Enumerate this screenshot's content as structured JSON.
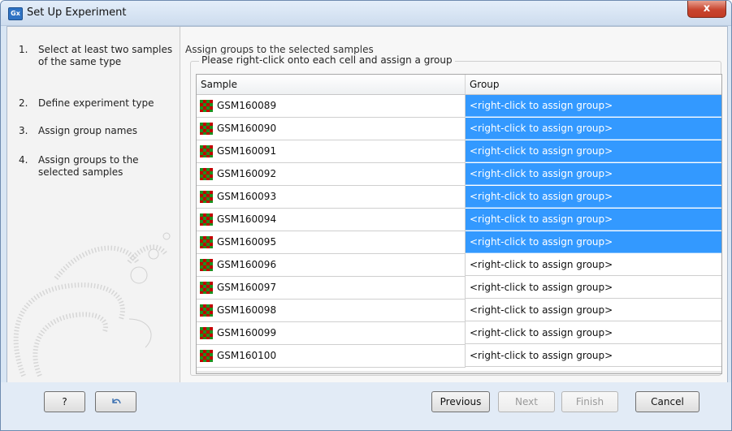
{
  "window": {
    "app_icon_text": "Gx",
    "title": "Set Up Experiment",
    "close_symbol": "x"
  },
  "sidebar": {
    "steps": [
      {
        "num": "1.",
        "label": "Select at least two samples of the same type"
      },
      {
        "num": "2.",
        "label": "Define experiment type"
      },
      {
        "num": "3.",
        "label": "Assign group names"
      },
      {
        "num": "4.",
        "label": "Assign groups to the selected samples"
      }
    ]
  },
  "main": {
    "heading": "Assign groups to the selected samples",
    "group_label": "Please right-click onto each cell and assign a group",
    "columns": [
      "Sample",
      "Group"
    ],
    "rows": [
      {
        "sample": "GSM160089",
        "group": "<right-click to assign group>",
        "selected": true
      },
      {
        "sample": "GSM160090",
        "group": "<right-click to assign group>",
        "selected": true
      },
      {
        "sample": "GSM160091",
        "group": "<right-click to assign group>",
        "selected": true
      },
      {
        "sample": "GSM160092",
        "group": "<right-click to assign group>",
        "selected": true
      },
      {
        "sample": "GSM160093",
        "group": "<right-click to assign group>",
        "selected": true
      },
      {
        "sample": "GSM160094",
        "group": "<right-click to assign group>",
        "selected": true
      },
      {
        "sample": "GSM160095",
        "group": "<right-click to assign group>",
        "selected": true
      },
      {
        "sample": "GSM160096",
        "group": "<right-click to assign group>",
        "selected": false
      },
      {
        "sample": "GSM160097",
        "group": "<right-click to assign group>",
        "selected": false
      },
      {
        "sample": "GSM160098",
        "group": "<right-click to assign group>",
        "selected": false
      },
      {
        "sample": "GSM160099",
        "group": "<right-click to assign group>",
        "selected": false
      },
      {
        "sample": "GSM160100",
        "group": "<right-click to assign group>",
        "selected": false
      }
    ]
  },
  "footer": {
    "help_label": "?",
    "reset_icon": "undo-arrow-icon",
    "previous_label": "Previous",
    "next_label": "Next",
    "finish_label": "Finish",
    "cancel_label": "Cancel",
    "next_enabled": false,
    "finish_enabled": false
  },
  "colors": {
    "selection": "#3399ff",
    "heatmap_red": "#c00000",
    "heatmap_green": "#1e8f1e"
  }
}
